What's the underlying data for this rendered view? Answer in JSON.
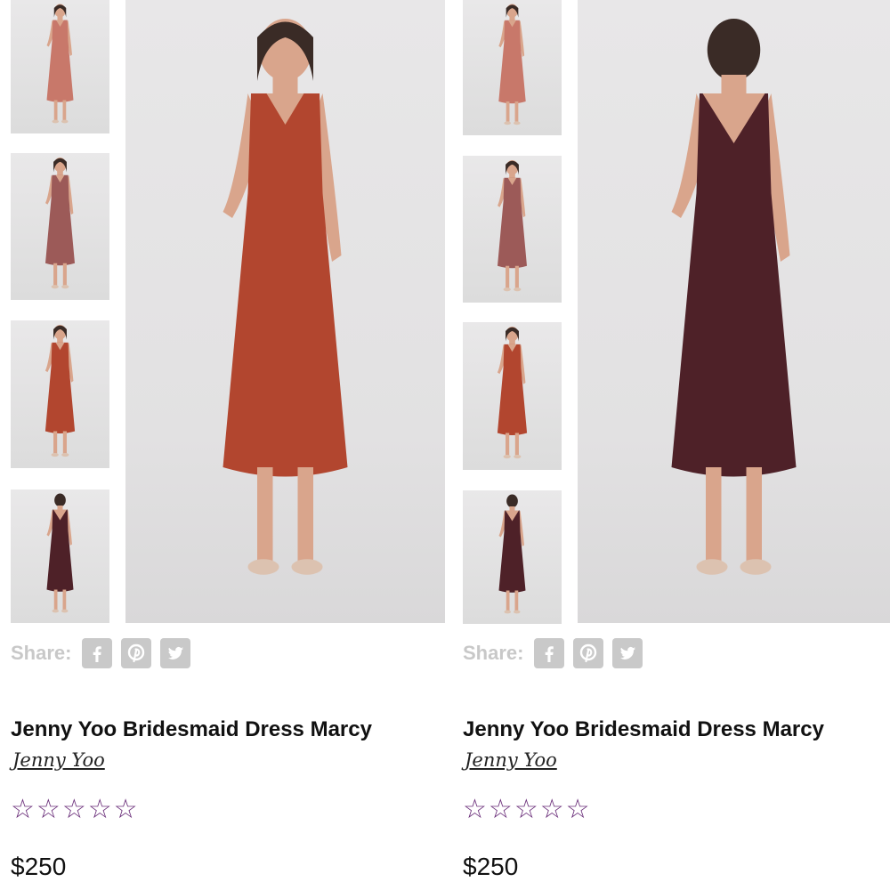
{
  "products": [
    {
      "title": "Jenny Yoo Bridesmaid Dress Marcy",
      "brand": "Jenny Yoo",
      "price": "$250",
      "share_label": "Share:",
      "rating": {
        "value": 0,
        "max": 5,
        "star_glyph": "☆"
      },
      "main_image": {
        "dress_color": "#b2462f",
        "view": "front"
      },
      "thumbnails": [
        {
          "dress_color": "#c8786a",
          "view": "front"
        },
        {
          "dress_color": "#9c5a58",
          "view": "front"
        },
        {
          "dress_color": "#b2462f",
          "view": "front"
        },
        {
          "dress_color": "#4e2128",
          "view": "back"
        }
      ],
      "social_icons": [
        "facebook-icon",
        "pinterest-icon",
        "twitter-icon"
      ]
    },
    {
      "title": "Jenny Yoo Bridesmaid Dress Marcy",
      "brand": "Jenny Yoo",
      "price": "$250",
      "share_label": "Share:",
      "rating": {
        "value": 0,
        "max": 5,
        "star_glyph": "☆"
      },
      "main_image": {
        "dress_color": "#4e2128",
        "view": "back"
      },
      "thumbnails": [
        {
          "dress_color": "#c8786a",
          "view": "front"
        },
        {
          "dress_color": "#9c5a58",
          "view": "front"
        },
        {
          "dress_color": "#b2462f",
          "view": "front"
        },
        {
          "dress_color": "#4e2128",
          "view": "back"
        }
      ],
      "social_icons": [
        "facebook-icon",
        "pinterest-icon",
        "twitter-icon"
      ]
    }
  ],
  "colors": {
    "star": "#6b2f7a",
    "share_gray": "#c9c9c9"
  }
}
